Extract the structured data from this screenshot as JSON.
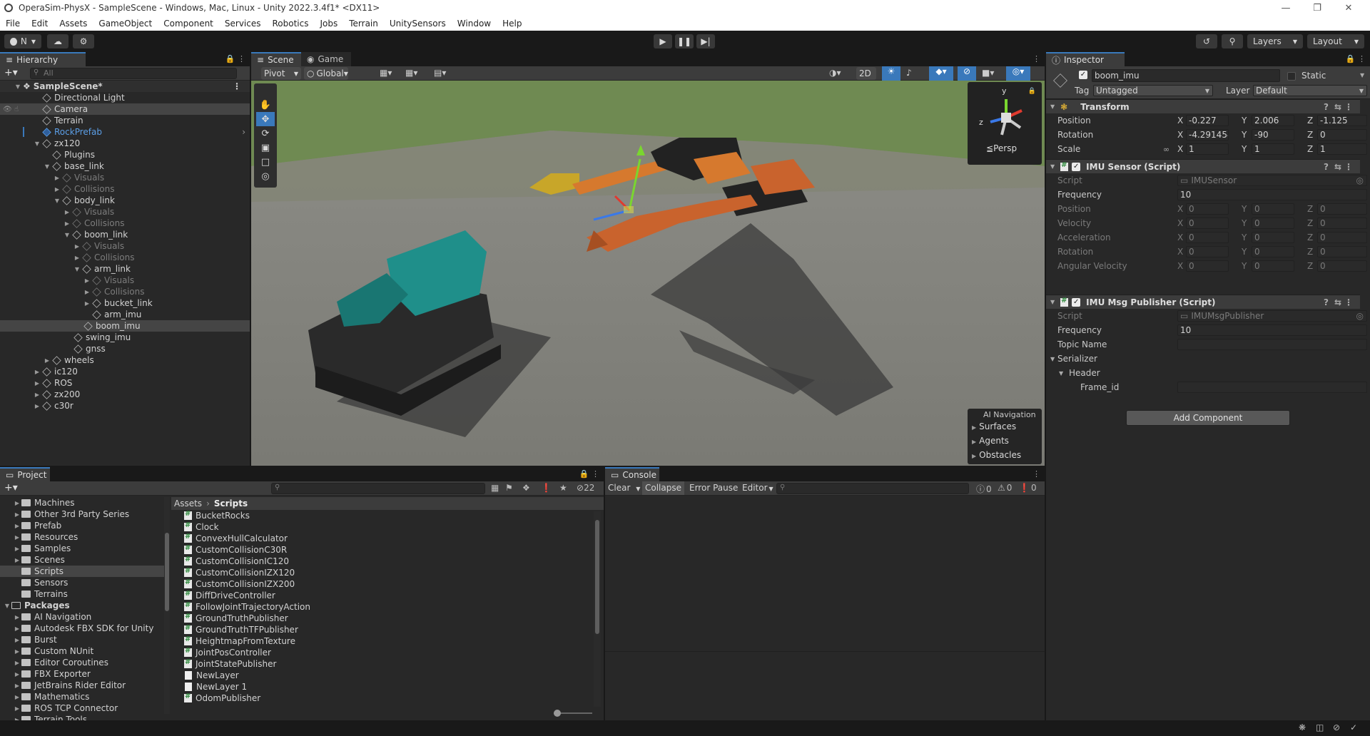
{
  "window": {
    "title": "OperaSim-PhysX - SampleScene - Windows, Mac, Linux - Unity 2022.3.4f1* <DX11>"
  },
  "menu": [
    "File",
    "Edit",
    "Assets",
    "GameObject",
    "Component",
    "Services",
    "Robotics",
    "Jobs",
    "Terrain",
    "UnitySensors",
    "Window",
    "Help"
  ],
  "toolbar": {
    "account_label": "N",
    "layers_label": "Layers",
    "layout_label": "Layout"
  },
  "hierarchy": {
    "tab_label": "Hierarchy",
    "search_placeholder": "All",
    "rows": [
      {
        "label": "SampleScene*"
      },
      {
        "label": "Directional Light"
      },
      {
        "label": "Camera"
      },
      {
        "label": "Terrain"
      },
      {
        "label": "RockPrefab"
      },
      {
        "label": "zx120"
      },
      {
        "label": "Plugins"
      },
      {
        "label": "base_link"
      },
      {
        "label": "Visuals"
      },
      {
        "label": "Collisions"
      },
      {
        "label": "body_link"
      },
      {
        "label": "Visuals"
      },
      {
        "label": "Collisions"
      },
      {
        "label": "boom_link"
      },
      {
        "label": "Visuals"
      },
      {
        "label": "Collisions"
      },
      {
        "label": "arm_link"
      },
      {
        "label": "Visuals"
      },
      {
        "label": "Collisions"
      },
      {
        "label": "bucket_link"
      },
      {
        "label": "arm_imu"
      },
      {
        "label": "boom_imu"
      },
      {
        "label": "swing_imu"
      },
      {
        "label": "gnss"
      },
      {
        "label": "wheels"
      },
      {
        "label": "ic120"
      },
      {
        "label": "ROS"
      },
      {
        "label": "zx200"
      },
      {
        "label": "c30r"
      }
    ]
  },
  "scene": {
    "tabs": [
      "Scene",
      "Game"
    ],
    "pivot_label": "Pivot",
    "global_label": "Global",
    "mode_2d_label": "2D",
    "persp_label": "Persp",
    "axis_labels": {
      "y": "y",
      "z": "z"
    },
    "ai_nav": {
      "title": "AI Navigation",
      "items": [
        "Surfaces",
        "Agents",
        "Obstacles"
      ]
    }
  },
  "inspector": {
    "tab_label": "Inspector",
    "object_name": "boom_imu",
    "static_label": "Static",
    "tag_label": "Tag",
    "tag_value": "Untagged",
    "layer_label": "Layer",
    "layer_value": "Default",
    "transform": {
      "title": "Transform",
      "position_label": "Position",
      "rotation_label": "Rotation",
      "scale_label": "Scale",
      "position": {
        "x": "-0.227",
        "y": "2.006",
        "z": "-1.125"
      },
      "rotation": {
        "x": "-4.291454",
        "y": "-90",
        "z": "0"
      },
      "scale": {
        "x": "1",
        "y": "1",
        "z": "1"
      }
    },
    "imu_sensor": {
      "title": "IMU Sensor (Script)",
      "script_label": "Script",
      "script_value": "IMUSensor",
      "frequency_label": "Frequency",
      "frequency_value": "10",
      "readonly_rows": [
        "Position",
        "Velocity",
        "Acceleration",
        "Rotation",
        "Angular Velocity"
      ],
      "zero": "0"
    },
    "imu_publisher": {
      "title": "IMU Msg Publisher (Script)",
      "script_label": "Script",
      "script_value": "IMUMsgPublisher",
      "frequency_label": "Frequency",
      "frequency_value": "10",
      "topic_label": "Topic Name",
      "topic_value": "",
      "serializer_label": "Serializer",
      "header_label": "Header",
      "frame_label": "Frame_id",
      "frame_value": ""
    },
    "add_component_label": "Add Component",
    "axes": {
      "x": "X",
      "y": "Y",
      "z": "Z"
    }
  },
  "project": {
    "tab_label": "Project",
    "hidden_count": "22",
    "breadcrumb_root": "Assets",
    "breadcrumb_current": "Scripts",
    "tree": [
      {
        "label": "Machines",
        "bold": false
      },
      {
        "label": "Other 3rd Party Series",
        "bold": false
      },
      {
        "label": "Prefab",
        "bold": false
      },
      {
        "label": "Resources",
        "bold": false
      },
      {
        "label": "Samples",
        "bold": false
      },
      {
        "label": "Scenes",
        "bold": false
      },
      {
        "label": "Scripts",
        "bold": false
      },
      {
        "label": "Sensors",
        "bold": false
      },
      {
        "label": "Terrains",
        "bold": false
      },
      {
        "label": "Packages",
        "bold": true
      },
      {
        "label": "AI Navigation",
        "bold": false
      },
      {
        "label": "Autodesk FBX SDK for Unity",
        "bold": false
      },
      {
        "label": "Burst",
        "bold": false
      },
      {
        "label": "Custom NUnit",
        "bold": false
      },
      {
        "label": "Editor Coroutines",
        "bold": false
      },
      {
        "label": "FBX Exporter",
        "bold": false
      },
      {
        "label": "JetBrains Rider Editor",
        "bold": false
      },
      {
        "label": "Mathematics",
        "bold": false
      },
      {
        "label": "ROS TCP Connector",
        "bold": false
      },
      {
        "label": "Terrain Tools",
        "bold": false
      }
    ],
    "files": [
      {
        "label": "BucketRocks",
        "kind": "cs"
      },
      {
        "label": "Clock",
        "kind": "cs"
      },
      {
        "label": "ConvexHullCalculator",
        "kind": "cs"
      },
      {
        "label": "CustomCollisionC30R",
        "kind": "cs"
      },
      {
        "label": "CustomCollisionIC120",
        "kind": "cs"
      },
      {
        "label": "CustomCollisionIZX120",
        "kind": "cs"
      },
      {
        "label": "CustomCollisionIZX200",
        "kind": "cs"
      },
      {
        "label": "DiffDriveController",
        "kind": "cs"
      },
      {
        "label": "FollowJointTrajectoryAction",
        "kind": "cs"
      },
      {
        "label": "GroundTruthPublisher",
        "kind": "cs"
      },
      {
        "label": "GroundTruthTFPublisher",
        "kind": "cs"
      },
      {
        "label": "HeightmapFromTexture",
        "kind": "cs"
      },
      {
        "label": "JointPosController",
        "kind": "cs"
      },
      {
        "label": "JointStatePublisher",
        "kind": "cs"
      },
      {
        "label": "NewLayer",
        "kind": "doc"
      },
      {
        "label": "NewLayer 1",
        "kind": "doc"
      },
      {
        "label": "OdomPublisher",
        "kind": "cs"
      }
    ]
  },
  "console": {
    "tab_label": "Console",
    "clear_label": "Clear",
    "collapse_label": "Collapse",
    "error_pause_label": "Error Pause",
    "editor_label": "Editor",
    "log_count": "0",
    "warn_count": "0",
    "error_count": "0"
  },
  "colors": {
    "accent": "#3a79bb",
    "link_blue": "#5c9fe7",
    "panel": "#282828",
    "header": "#3c3c3c"
  }
}
